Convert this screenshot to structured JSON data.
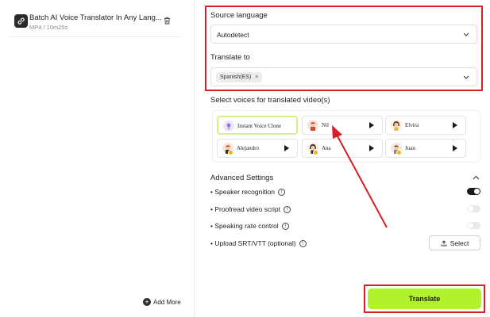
{
  "files": {
    "item": {
      "title": "Batch AI Voice Translator In Any Lang...",
      "meta": "MP4 / 10m25s",
      "icon": "link-icon",
      "delete_icon": "trash-icon"
    },
    "add_more_label": "Add More"
  },
  "source_language": {
    "label": "Source language",
    "value": "Autodetect"
  },
  "translate_to": {
    "label": "Translate to",
    "chips": [
      "Spanish(ES)"
    ],
    "chip_remove": "×"
  },
  "voices": {
    "label": "Select voices for translated video(s)",
    "items": [
      {
        "name": "Instant Voice Clone",
        "selected": true
      },
      {
        "name": "Nil"
      },
      {
        "name": "Elvira"
      },
      {
        "name": "Alejandro"
      },
      {
        "name": "Ana"
      },
      {
        "name": "Juan"
      }
    ]
  },
  "advanced": {
    "title": "Advanced Settings",
    "options": [
      {
        "label": "• Speaker recognition",
        "enabled": true
      },
      {
        "label": "• Proofread video script",
        "enabled": false
      },
      {
        "label": "• Speaking rate control",
        "enabled": false
      },
      {
        "label": "• Upload SRT/VTT (optional)"
      }
    ],
    "info_glyph": "!",
    "select_label": "Select"
  },
  "translate_button": "Translate",
  "colors": {
    "accent": "#b2f22c",
    "highlight": "#d81f26",
    "selected_border": "#d8f08a"
  }
}
